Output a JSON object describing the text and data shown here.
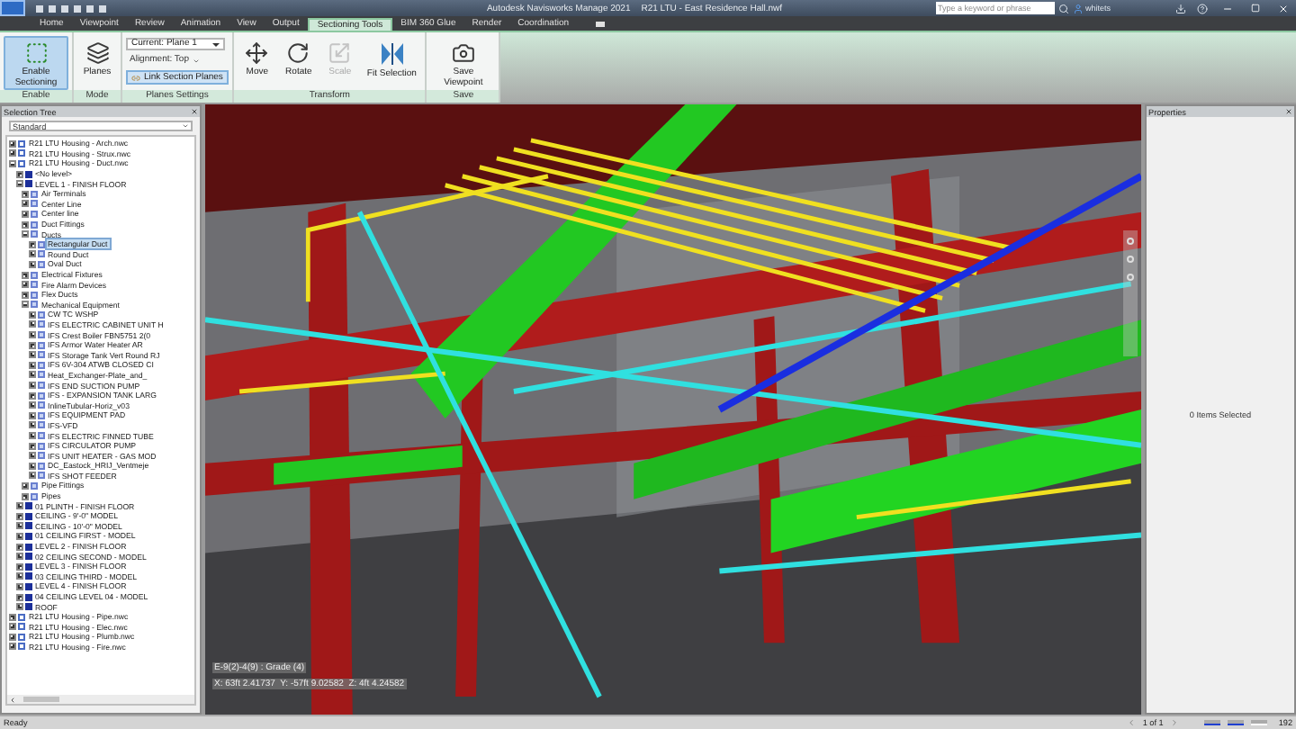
{
  "title_bar": {
    "app": "Autodesk Navisworks Manage 2021",
    "file": "R21 LTU - East Residence Hall.nwf",
    "search": {
      "placeholder": "Type a keyword or phrase"
    },
    "user": "whitets"
  },
  "tabs": [
    {
      "label": "Home",
      "selected": false
    },
    {
      "label": "Viewpoint",
      "selected": false
    },
    {
      "label": "Review",
      "selected": false
    },
    {
      "label": "Animation",
      "selected": false
    },
    {
      "label": "View",
      "selected": false
    },
    {
      "label": "Output",
      "selected": false
    },
    {
      "label": "Sectioning Tools",
      "selected": true
    },
    {
      "label": "BIM 360 Glue",
      "selected": false
    },
    {
      "label": "Render",
      "selected": false
    },
    {
      "label": "Coordination",
      "selected": false
    }
  ],
  "ribbon": {
    "groups": [
      {
        "label": "Enable",
        "tools": [
          {
            "kind": "large",
            "label": "Enable Sectioning",
            "active": true,
            "disabled": false
          }
        ]
      },
      {
        "label": "Mode",
        "tools": [
          {
            "kind": "large",
            "label": "Planes",
            "active": false,
            "disabled": false
          }
        ]
      },
      {
        "label": "Planes Settings",
        "tools": [
          {
            "kind": "dropdown",
            "label": "Current: Plane 1",
            "active": false,
            "disabled": false
          },
          {
            "kind": "menu",
            "label": "Alignment: Top",
            "active": false,
            "disabled": false
          },
          {
            "kind": "toggle",
            "label": "Link Section Planes",
            "active": true,
            "disabled": false
          }
        ]
      },
      {
        "label": "Transform",
        "tools": [
          {
            "kind": "large",
            "label": "Move",
            "active": false,
            "disabled": false
          },
          {
            "kind": "large",
            "label": "Rotate",
            "active": false,
            "disabled": false
          },
          {
            "kind": "large",
            "label": "Scale",
            "active": false,
            "disabled": true
          },
          {
            "kind": "large",
            "label": "Fit Selection",
            "active": false,
            "disabled": false
          }
        ]
      },
      {
        "label": "Save",
        "tools": [
          {
            "kind": "large",
            "label": "Save Viewpoint",
            "active": false,
            "disabled": false
          }
        ]
      }
    ]
  },
  "selection_tree": {
    "title": "Selection Tree",
    "mode": "Standard",
    "items": [
      {
        "label": "R21 LTU Housing - Arch.nwc",
        "kind": "file",
        "expanded": false,
        "selected": false
      },
      {
        "label": "R21 LTU Housing - Strux.nwc",
        "kind": "file",
        "expanded": false,
        "selected": false
      },
      {
        "label": "R21 LTU Housing - Duct.nwc",
        "kind": "file",
        "expanded": true,
        "selected": false,
        "children": [
          {
            "label": "<No level>",
            "kind": "level",
            "expanded": false,
            "selected": false
          },
          {
            "label": "LEVEL 1 - FINISH FLOOR",
            "kind": "level",
            "expanded": true,
            "selected": false,
            "children": [
              {
                "label": "Air Terminals",
                "kind": "group",
                "expanded": false,
                "selected": false
              },
              {
                "label": "Center Line",
                "kind": "group",
                "expanded": false,
                "selected": false
              },
              {
                "label": "Center line",
                "kind": "group",
                "expanded": false,
                "selected": false
              },
              {
                "label": "Duct Fittings",
                "kind": "group",
                "expanded": false,
                "selected": false
              },
              {
                "label": "Ducts",
                "kind": "group",
                "expanded": true,
                "selected": false,
                "children": [
                  {
                    "label": "Rectangular Duct",
                    "kind": "group",
                    "expanded": false,
                    "selected": true
                  },
                  {
                    "label": "Round Duct",
                    "kind": "group",
                    "expanded": false,
                    "selected": false
                  },
                  {
                    "label": "Oval Duct",
                    "kind": "group",
                    "expanded": false,
                    "selected": false
                  }
                ]
              },
              {
                "label": "Electrical Fixtures",
                "kind": "group",
                "expanded": false,
                "selected": false
              },
              {
                "label": "Fire Alarm Devices",
                "kind": "group",
                "expanded": false,
                "selected": false
              },
              {
                "label": "Flex Ducts",
                "kind": "group",
                "expanded": false,
                "selected": false
              },
              {
                "label": "Mechanical Equipment",
                "kind": "group",
                "expanded": true,
                "selected": false,
                "children": [
                  {
                    "label": "CW TC WSHP",
                    "kind": "group",
                    "expanded": false,
                    "selected": false
                  },
                  {
                    "label": "IFS ELECTRIC CABINET UNIT H",
                    "kind": "group",
                    "expanded": false,
                    "selected": false
                  },
                  {
                    "label": "IFS Crest Boiler FBN5751 2(0",
                    "kind": "group",
                    "expanded": false,
                    "selected": false
                  },
                  {
                    "label": "IFS Armor Water Heater AR",
                    "kind": "group",
                    "expanded": false,
                    "selected": false
                  },
                  {
                    "label": "IFS Storage Tank Vert Round RJ",
                    "kind": "group",
                    "expanded": false,
                    "selected": false
                  },
                  {
                    "label": "IFS 6V-304 ATWB CLOSED CI",
                    "kind": "group",
                    "expanded": false,
                    "selected": false
                  },
                  {
                    "label": "Heat_Exchanger-Plate_and_",
                    "kind": "group",
                    "expanded": false,
                    "selected": false
                  },
                  {
                    "label": "IFS END SUCTION PUMP",
                    "kind": "group",
                    "expanded": false,
                    "selected": false
                  },
                  {
                    "label": "IFS - EXPANSION TANK LARG",
                    "kind": "group",
                    "expanded": false,
                    "selected": false
                  },
                  {
                    "label": "InlineTubular-Horiz_v03",
                    "kind": "group",
                    "expanded": false,
                    "selected": false
                  },
                  {
                    "label": "IFS EQUIPMENT PAD",
                    "kind": "group",
                    "expanded": false,
                    "selected": false
                  },
                  {
                    "label": "IFS-VFD",
                    "kind": "group",
                    "expanded": false,
                    "selected": false
                  },
                  {
                    "label": "IFS ELECTRIC FINNED TUBE",
                    "kind": "group",
                    "expanded": false,
                    "selected": false
                  },
                  {
                    "label": "IFS CIRCULATOR PUMP",
                    "kind": "group",
                    "expanded": false,
                    "selected": false
                  },
                  {
                    "label": "IFS UNIT HEATER - GAS MOD",
                    "kind": "group",
                    "expanded": false,
                    "selected": false
                  },
                  {
                    "label": "DC_Eastock_HRIJ_Ventmeje",
                    "kind": "group",
                    "expanded": false,
                    "selected": false
                  },
                  {
                    "label": "IFS SHOT FEEDER",
                    "kind": "group",
                    "expanded": false,
                    "selected": false
                  }
                ]
              },
              {
                "label": "Pipe Fittings",
                "kind": "group",
                "expanded": false,
                "selected": false
              },
              {
                "label": "Pipes",
                "kind": "group",
                "expanded": false,
                "selected": false
              }
            ]
          },
          {
            "label": "01 PLINTH - FINISH FLOOR",
            "kind": "level",
            "expanded": false,
            "selected": false
          },
          {
            "label": "CEILING - 9'-0\" MODEL",
            "kind": "level",
            "expanded": false,
            "selected": false
          },
          {
            "label": "CEILING - 10'-0\" MODEL",
            "kind": "level",
            "expanded": false,
            "selected": false
          },
          {
            "label": "01 CEILING FIRST - MODEL",
            "kind": "level",
            "expanded": false,
            "selected": false
          },
          {
            "label": "LEVEL 2 - FINISH FLOOR",
            "kind": "level",
            "expanded": false,
            "selected": false
          },
          {
            "label": "02 CEILING SECOND - MODEL",
            "kind": "level",
            "expanded": false,
            "selected": false
          },
          {
            "label": "LEVEL 3 - FINISH FLOOR",
            "kind": "level",
            "expanded": false,
            "selected": false
          },
          {
            "label": "03 CEILING THIRD - MODEL",
            "kind": "level",
            "expanded": false,
            "selected": false
          },
          {
            "label": "LEVEL 4 - FINISH FLOOR",
            "kind": "level",
            "expanded": false,
            "selected": false
          },
          {
            "label": "04 CEILING LEVEL 04 - MODEL",
            "kind": "level",
            "expanded": false,
            "selected": false
          },
          {
            "label": "ROOF",
            "kind": "level",
            "expanded": false,
            "selected": false
          }
        ]
      },
      {
        "label": "R21 LTU Housing - Pipe.nwc",
        "kind": "file",
        "expanded": false,
        "selected": false
      },
      {
        "label": "R21 LTU Housing - Elec.nwc",
        "kind": "file",
        "expanded": false,
        "selected": false
      },
      {
        "label": "R21 LTU Housing - Plumb.nwc",
        "kind": "file",
        "expanded": false,
        "selected": false
      },
      {
        "label": "R21 LTU Housing - Fire.nwc",
        "kind": "file",
        "expanded": false,
        "selected": false
      }
    ]
  },
  "viewport": {
    "grid_location": "E-9(2)-4(9) : Grade (4)",
    "coordinates": "X: 63ft 2.41737  Y: -57ft 9.02582  Z: 4ft 4.24582"
  },
  "properties": {
    "title": "Properties",
    "message": "0 Items Selected"
  },
  "status_bar": {
    "status": "Ready",
    "page": "1 of 1",
    "memory": "192"
  }
}
